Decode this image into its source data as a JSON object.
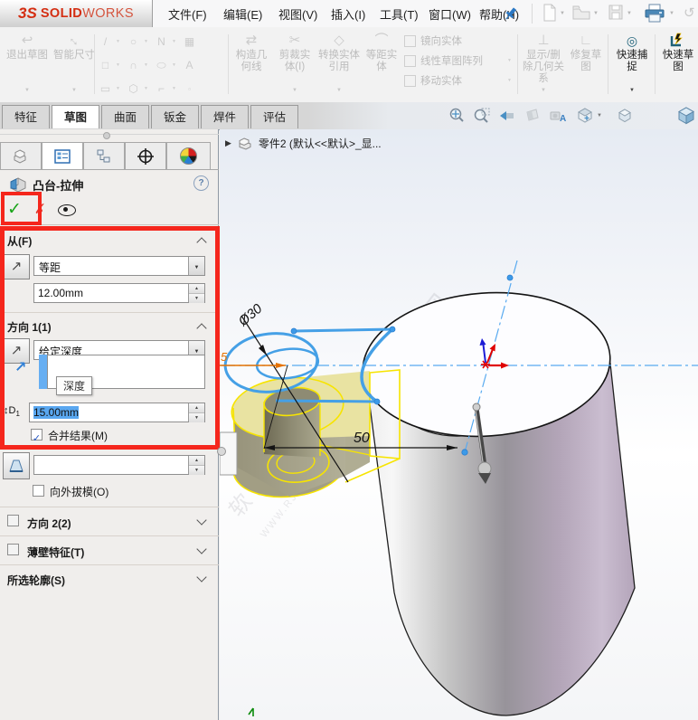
{
  "logo": {
    "mark": "3S",
    "name1": "SOLID",
    "name2": "WORKS"
  },
  "menu": {
    "items": [
      "文件(F)",
      "编辑(E)",
      "视图(V)",
      "插入(I)",
      "工具(T)",
      "窗口(W)",
      "帮助(H)"
    ]
  },
  "toolbar": {
    "exit_sketch": "退出草图",
    "smart_dimension": "智能尺寸",
    "construction_geometry": "构造几何线",
    "trim_entities": "剪裁实体(I)",
    "convert_entities": "转换实体引用",
    "offset_entities": "等距实体",
    "mirror_entities": "镜向实体",
    "linear_pattern": "线性草图阵列",
    "move_entities": "移动实体",
    "display_delete_relations": "显示/删除几何关系",
    "repair_sketch": "修复草图",
    "quick_snaps": "快速捕捉",
    "rapid_sketch": "快速草图"
  },
  "tabs": [
    "特征",
    "草图",
    "曲面",
    "钣金",
    "焊件",
    "评估"
  ],
  "property_panel": {
    "title": "凸台-拉伸",
    "help": "?",
    "from": {
      "label": "从(F)",
      "dropdown": "等距",
      "value": "12.00mm"
    },
    "direction1": {
      "label": "方向 1(1)",
      "dropdown": "给定深度",
      "tooltip": "深度",
      "depth_value": "15.00mm",
      "merge_checkbox": "合并结果(M)",
      "draft_checkbox": "向外拔模(O)"
    },
    "direction2": {
      "label": "方向 2(2)"
    },
    "thin_feature": {
      "label": "薄壁特征(T)"
    },
    "selected_contours": {
      "label": "所选轮廓(S)"
    }
  },
  "viewport": {
    "tree_item": "零件2 (默认<<默认>_显...",
    "dimensions": {
      "diameter": "Ø30",
      "distance": "50",
      "offset": "5"
    },
    "watermark": {
      "line1": "软件自学网",
      "line2": "WWW.RJZXW.COM"
    }
  },
  "colors": {
    "annotation_red": "#f5261c",
    "preview_yellow": "#f7e400",
    "sketch_blue": "#45a0e6",
    "brand_red": "#d42e12"
  }
}
